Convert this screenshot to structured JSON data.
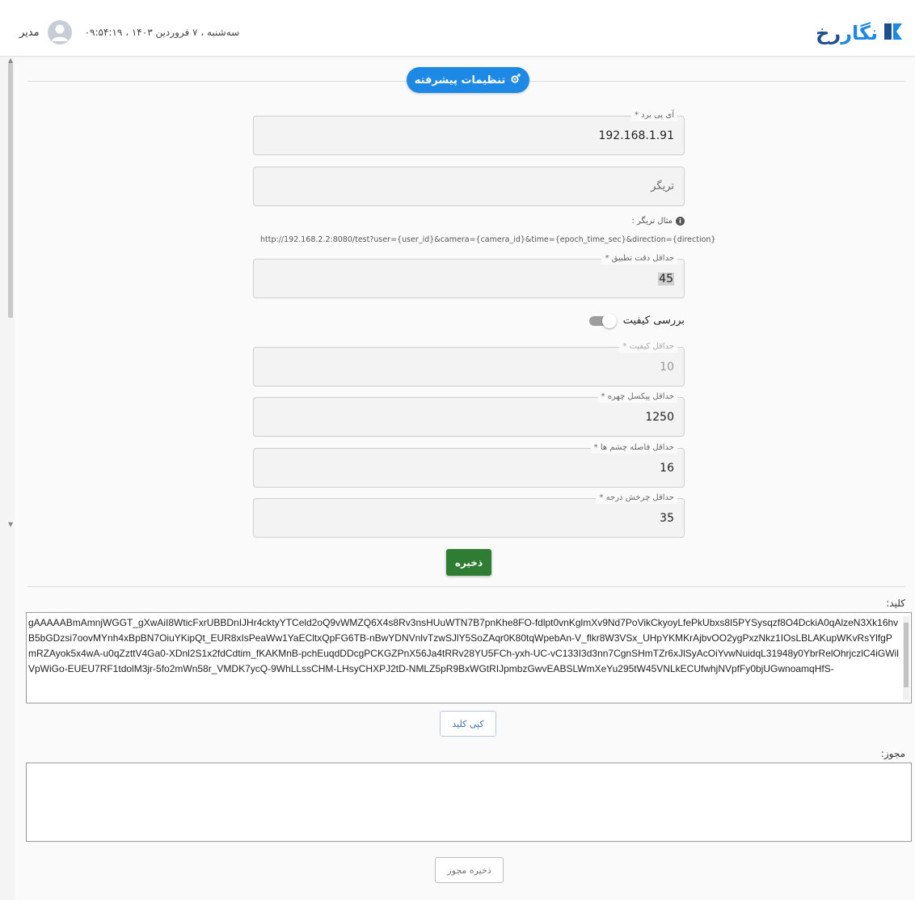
{
  "header": {
    "brand": {
      "part1": "رخ",
      "part2": "نگار"
    },
    "datetime": "سه‌شنبه ، ۷ فروردین ۱۴۰۳ ، ۰۹:۵۴:۱۹",
    "user_name": "مدیر"
  },
  "section": {
    "title": "تنظیمات پیشرفته"
  },
  "form": {
    "board_ip": {
      "label": "آی پی برد *",
      "value": "192.168.1.91"
    },
    "trigger": {
      "placeholder": "تریگر"
    },
    "trigger_example": {
      "label": "مثال تریگر :",
      "url": "http://192.168.2.2:8080/test?user={user_id}&camera={camera_id}&time={epoch_time_sec}&direction={direction}"
    },
    "min_match": {
      "label": "حداقل دقت تطبیق *",
      "value": "45"
    },
    "quality_check": {
      "label": "بررسی کیفیت",
      "enabled": false
    },
    "min_quality": {
      "label": "حداقل کیفیت *",
      "value": "10"
    },
    "min_face_pixels": {
      "label": "حداقل پیکسل چهره *",
      "value": "1250"
    },
    "min_eye_distance": {
      "label": "حداقل فاصله چشم ها *",
      "value": "16"
    },
    "min_rotation": {
      "label": "حداقل چرخش درجه *",
      "value": "35"
    },
    "save_label": "ذخیره"
  },
  "key_section": {
    "label": "کلید:",
    "value": "gAAAAABmAmnjWGGT_gXwAiI8WticFxrUBBDnIJHr4cktyYTCeld2oQ9vWMZQ6X4s8Rv3nsHUuWTN7B7pnKhe8FO-fdlpt0vnKglmXv9Nd7PoVikCkyoyLfePkUbxs8I5PYSysqzf8O4DckiA0qAlzeN3Xk16hvB5bGDzsi7oovMYnh4xBpBN7OiuYKipQt_EUR8xIsPeaWw1YaECltxQpFG6TB-nBwYDNVnlvTzwSJlY5SoZAqr0K80tqWpebAn-V_flkr8W3VSx_UHpYKMKrAjbvOO2ygPxzNkz1IOsLBLAKupWKvRsYlfgPmRZAyok5x4wA-u0qZzttV4Ga0-XDnl2S1x2fdCdtim_fKAKMnB-pchEuqdDDcgPCKGZPnX56Ja4tRRv28YU5FCh-yxh-UC-vC133I3d3nn7CgnSHmTZr6xJlSyAcOiYvwNuidqL31948y0YbrRelOhrjczlC4iGWilVpWiGo-EUEU7RF1tdolM3jr-5fo2mWn58r_VMDK7ycQ-9WhLLssCHM-LHsyCHXPJ2tD-NMLZ5pR9BxWGtRIJpmbzGwvEABSLWmXeYu295tW45VNLkECUfwhjNVpfFy0bjUGwnoamqHfS-",
    "copy_label": "کپی کلید"
  },
  "license_section": {
    "label": "مجوز:",
    "value": "",
    "save_label": "ذخیره مجوز"
  },
  "colors": {
    "primary": "#1e88e5",
    "save_green": "#2e7d32",
    "brand_dark": "#1e4f8c"
  }
}
